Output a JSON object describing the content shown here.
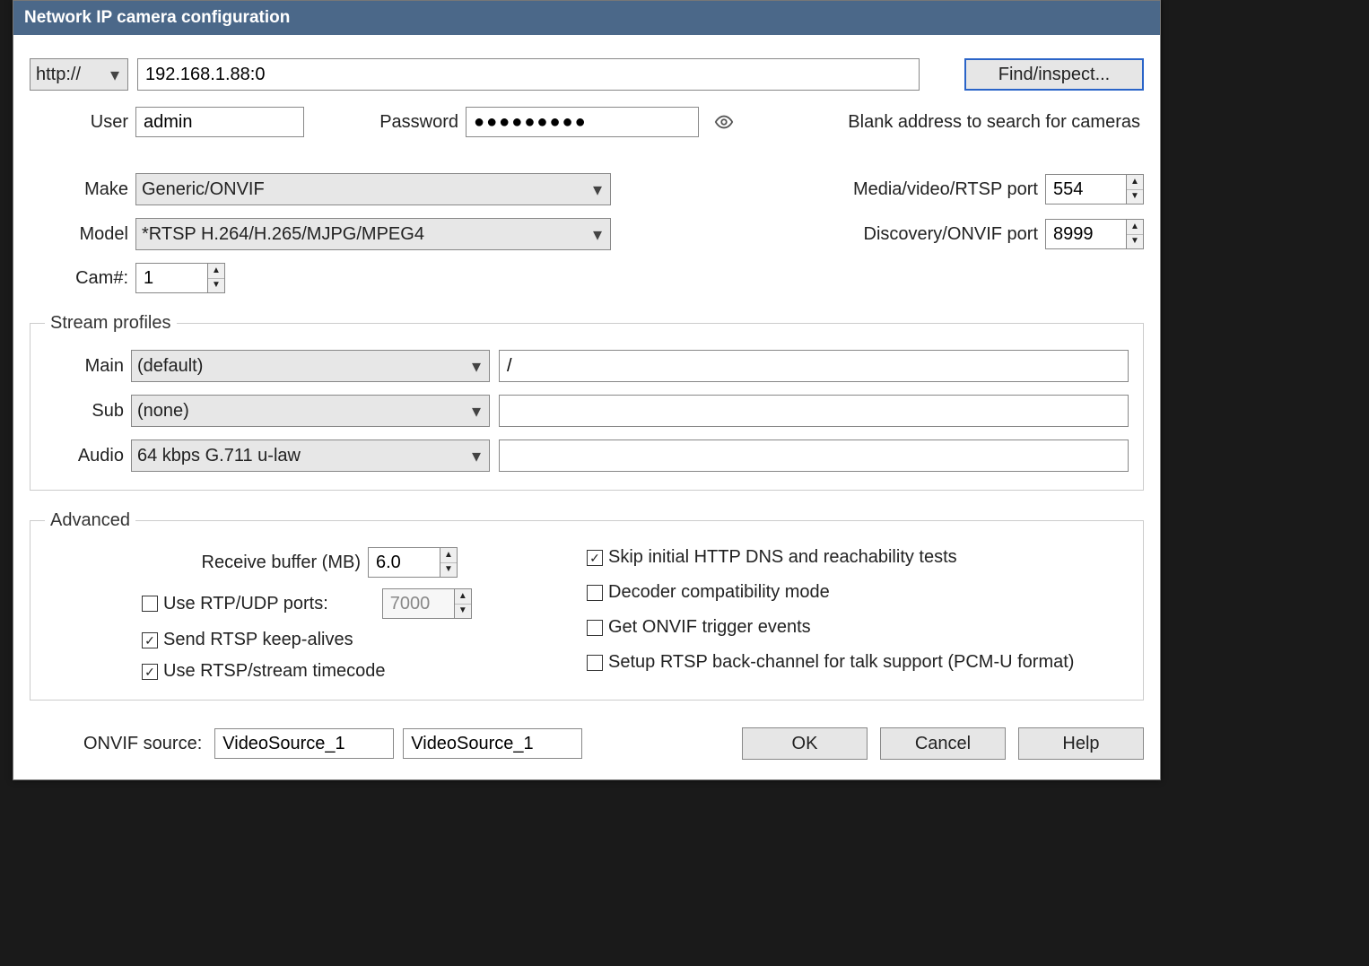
{
  "window": {
    "title": "Network IP camera configuration"
  },
  "top": {
    "protocol": "http://",
    "address": "192.168.1.88:0",
    "find_inspect": "Find/inspect...",
    "user_label": "User",
    "user_value": "admin",
    "password_label": "Password",
    "password_mask": "●●●●●●●●●",
    "blank_note": "Blank address to search for cameras"
  },
  "device": {
    "make_label": "Make",
    "make_value": "Generic/ONVIF",
    "model_label": "Model",
    "model_value": "*RTSP H.264/H.265/MJPG/MPEG4",
    "cam_label": "Cam#:",
    "cam_value": "1",
    "rtsp_port_label": "Media/video/RTSP port",
    "rtsp_port_value": "554",
    "onvif_port_label": "Discovery/ONVIF port",
    "onvif_port_value": "8999"
  },
  "streams": {
    "legend": "Stream profiles",
    "main_label": "Main",
    "main_select": "(default)",
    "main_path": "/",
    "sub_label": "Sub",
    "sub_select": "(none)",
    "sub_path": "",
    "audio_label": "Audio",
    "audio_select": "64 kbps G.711 u-law",
    "audio_path": ""
  },
  "advanced": {
    "legend": "Advanced",
    "recv_buffer_label": "Receive buffer (MB)",
    "recv_buffer_value": "6.0",
    "rtp_udp_label": "Use RTP/UDP ports:",
    "rtp_udp_value": "7000",
    "keep_alive_label": "Send RTSP keep-alives",
    "timecode_label": "Use RTSP/stream timecode",
    "skip_dns_label": "Skip initial HTTP DNS and reachability tests",
    "decoder_compat_label": "Decoder compatibility mode",
    "onvif_trigger_label": "Get ONVIF trigger events",
    "backchannel_label": "Setup RTSP back-channel for talk support (PCM-U format)",
    "checked": {
      "rtp_udp": false,
      "keep_alive": true,
      "timecode": true,
      "skip_dns": true,
      "decoder_compat": false,
      "onvif_trigger": false,
      "backchannel": false
    }
  },
  "footer": {
    "onvif_source_label": "ONVIF source:",
    "onvif_source_a": "VideoSource_1",
    "onvif_source_b": "VideoSource_1",
    "ok": "OK",
    "cancel": "Cancel",
    "help": "Help"
  }
}
